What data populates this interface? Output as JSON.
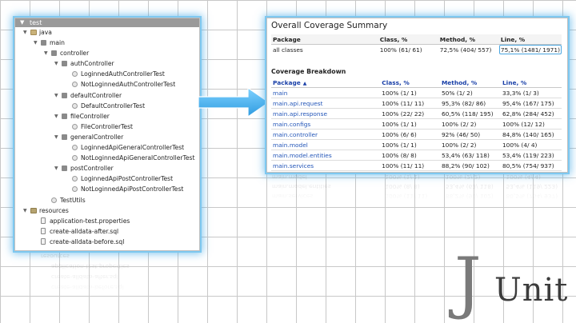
{
  "project_tree": {
    "root": "test",
    "rows": [
      {
        "label": "java",
        "indent": 1,
        "type": "folder",
        "expanded": true
      },
      {
        "label": "main",
        "indent": 2,
        "type": "pkg",
        "expanded": true
      },
      {
        "label": "controller",
        "indent": 3,
        "type": "pkg",
        "expanded": true
      },
      {
        "label": "authController",
        "indent": 4,
        "type": "pkg",
        "expanded": true
      },
      {
        "label": "LoginnedAuthControllerTest",
        "indent": 5,
        "type": "cls"
      },
      {
        "label": "NotLoginnedAuthControllerTest",
        "indent": 5,
        "type": "cls"
      },
      {
        "label": "defaultController",
        "indent": 4,
        "type": "pkg",
        "expanded": true
      },
      {
        "label": "DefaultControllerTest",
        "indent": 5,
        "type": "cls"
      },
      {
        "label": "fileController",
        "indent": 4,
        "type": "pkg",
        "expanded": true
      },
      {
        "label": "FileControllerTest",
        "indent": 5,
        "type": "cls"
      },
      {
        "label": "generalController",
        "indent": 4,
        "type": "pkg",
        "expanded": true
      },
      {
        "label": "LoginnedApiGeneralControllerTest",
        "indent": 5,
        "type": "cls"
      },
      {
        "label": "NotLoginnedApiGeneralControllerTest",
        "indent": 5,
        "type": "cls"
      },
      {
        "label": "postController",
        "indent": 4,
        "type": "pkg",
        "expanded": true
      },
      {
        "label": "LoginnedApiPostControllerTest",
        "indent": 5,
        "type": "cls"
      },
      {
        "label": "NotLoginnedApiPostControllerTest",
        "indent": 5,
        "type": "cls"
      },
      {
        "label": "TestUtils",
        "indent": 3,
        "type": "cls"
      },
      {
        "label": "resources",
        "indent": 1,
        "type": "res",
        "expanded": true
      },
      {
        "label": "application-test.properties",
        "indent": 2,
        "type": "file"
      },
      {
        "label": "create-alldata-after.sql",
        "indent": 2,
        "type": "file"
      },
      {
        "label": "create-alldata-before.sql",
        "indent": 2,
        "type": "file"
      }
    ]
  },
  "coverage": {
    "title": "Overall Coverage Summary",
    "columns": [
      "Package",
      "Class, %",
      "Method, %",
      "Line, %"
    ],
    "overall": {
      "package": "all classes",
      "class": "100% (61/ 61)",
      "method": "72,5% (404/ 557)",
      "line": "75,1% (1481/ 1971)"
    },
    "breakdown_title": "Coverage Breakdown",
    "sort_icon": "sort-ascending-icon",
    "breakdown": [
      {
        "package": "main",
        "class": "100% (1/ 1)",
        "method": "50% (1/ 2)",
        "line": "33,3% (1/ 3)"
      },
      {
        "package": "main.api.request",
        "class": "100% (11/ 11)",
        "method": "95,3% (82/ 86)",
        "line": "95,4% (167/ 175)"
      },
      {
        "package": "main.api.response",
        "class": "100% (22/ 22)",
        "method": "60,5% (118/ 195)",
        "line": "62,8% (284/ 452)"
      },
      {
        "package": "main.configs",
        "class": "100% (1/ 1)",
        "method": "100% (2/ 2)",
        "line": "100% (12/ 12)"
      },
      {
        "package": "main.controller",
        "class": "100% (6/ 6)",
        "method": "92% (46/ 50)",
        "line": "84,8% (140/ 165)"
      },
      {
        "package": "main.model",
        "class": "100% (1/ 1)",
        "method": "100% (2/ 2)",
        "line": "100% (4/ 4)"
      },
      {
        "package": "main.model.entities",
        "class": "100% (8/ 8)",
        "method": "53,4% (63/ 118)",
        "line": "53,4% (119/ 223)"
      },
      {
        "package": "main.services",
        "class": "100% (11/ 11)",
        "method": "88,2% (90/ 102)",
        "line": "80,5% (754/ 937)"
      }
    ]
  },
  "logo": {
    "j": "J",
    "unit": "Unit"
  },
  "colors": {
    "accent": "#4aa6e0",
    "link": "#2255b8"
  }
}
